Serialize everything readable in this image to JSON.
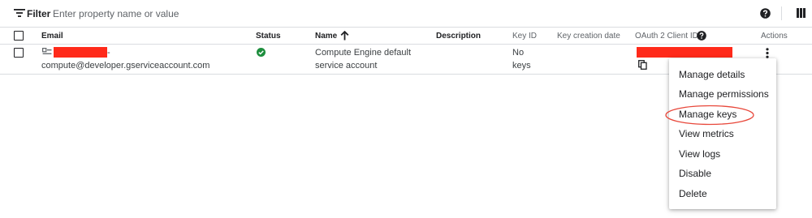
{
  "filter": {
    "label": "Filter",
    "placeholder": "Enter property name or value"
  },
  "columns": {
    "email": "Email",
    "status": "Status",
    "name": "Name",
    "description": "Description",
    "key_id": "Key ID",
    "key_creation_date": "Key creation date",
    "oauth_client_id": "OAuth 2 Client ID",
    "actions": "Actions"
  },
  "row": {
    "email_suffix": "-",
    "email": "compute@developer.gserviceaccount.com",
    "name_line1": "Compute Engine default",
    "name_line2": "service account",
    "key_id_line1": "No",
    "key_id_line2": "keys"
  },
  "menu": {
    "items": [
      "Manage details",
      "Manage permissions",
      "Manage keys",
      "View metrics",
      "View logs",
      "Disable",
      "Delete"
    ]
  },
  "colors": {
    "status_ok": "#1e8e3e",
    "redaction": "#ff2a1a",
    "highlight_ellipse": "#e8473a"
  }
}
